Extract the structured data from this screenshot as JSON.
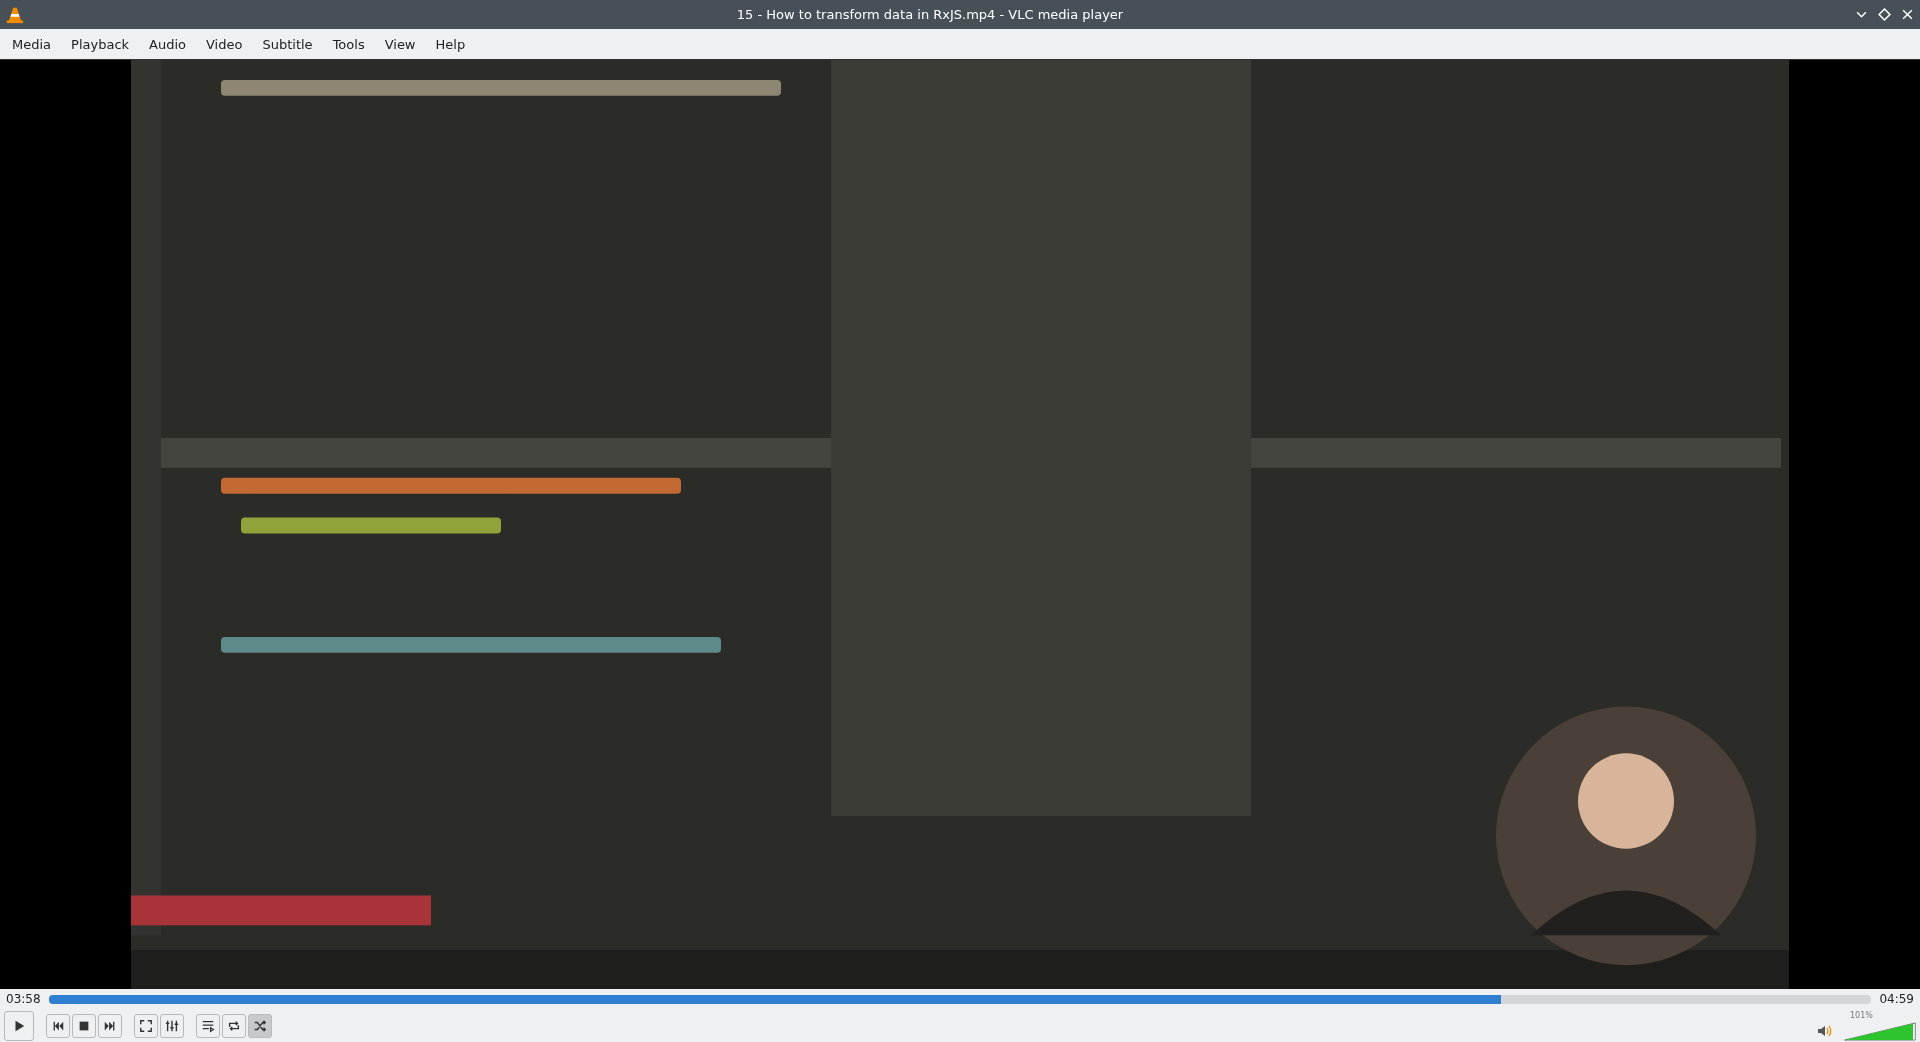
{
  "window": {
    "title": "15 - How to transform data in RxJS.mp4 - VLC media player"
  },
  "menu": [
    {
      "label": "Media"
    },
    {
      "label": "Playback"
    },
    {
      "label": "Audio"
    },
    {
      "label": "Video"
    },
    {
      "label": "Subtitle"
    },
    {
      "label": "Tools"
    },
    {
      "label": "View"
    },
    {
      "label": "Help"
    }
  ],
  "seek": {
    "elapsed": "03:58",
    "total": "04:59",
    "level": 0.797
  },
  "controls": [
    {
      "kind": "play",
      "on": false
    },
    {
      "kind": "prev",
      "on": false
    },
    {
      "kind": "stop",
      "on": false
    },
    {
      "kind": "next",
      "on": false
    },
    {
      "kind": "fullscreen",
      "on": false
    },
    {
      "kind": "settings",
      "on": false
    },
    {
      "kind": "playlist",
      "on": false
    },
    {
      "kind": "loop",
      "on": false
    },
    {
      "kind": "shuffle",
      "on": true
    }
  ],
  "volume": {
    "reading": "101%",
    "level": 0.96
  }
}
